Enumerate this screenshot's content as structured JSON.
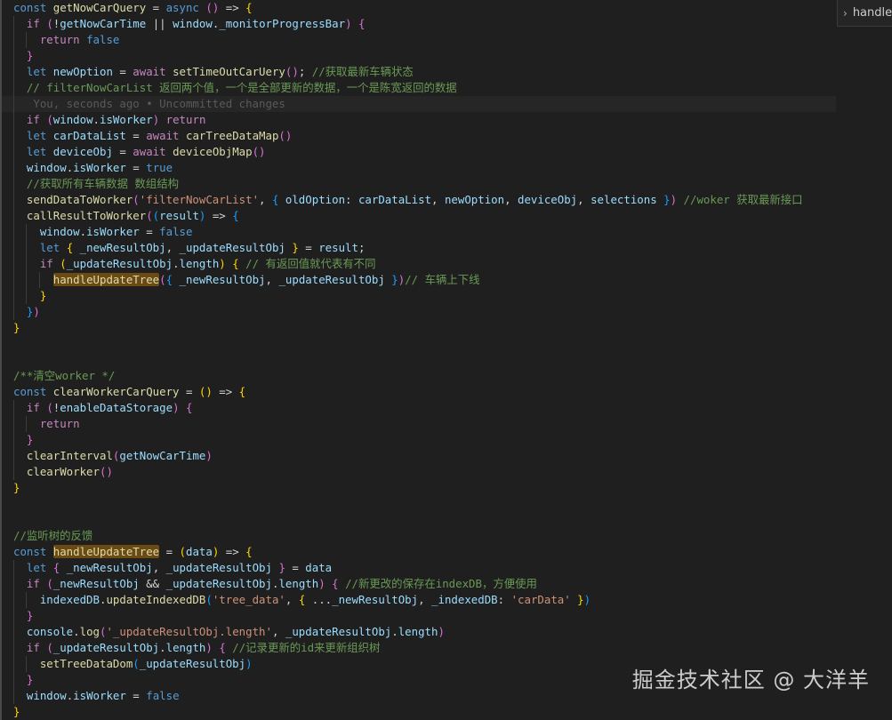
{
  "breadcrumb": {
    "label": "handle"
  },
  "watermark": "掘金技术社区 @ 大洋羊",
  "code_lines": [
    {
      "indent": 0,
      "current": false,
      "tokens": [
        [
          "kw",
          "const "
        ],
        [
          "fn",
          "getNowCarQuery"
        ],
        [
          "p",
          " = "
        ],
        [
          "kw",
          "async "
        ],
        [
          "b2",
          "()"
        ],
        [
          "p",
          " => "
        ],
        [
          "b1",
          "{"
        ]
      ]
    },
    {
      "indent": 1,
      "current": false,
      "tokens": [
        [
          "ctl",
          "if "
        ],
        [
          "b2",
          "("
        ],
        [
          "p",
          "!"
        ],
        [
          "var",
          "getNowCarTime"
        ],
        [
          "p",
          " || "
        ],
        [
          "var",
          "window"
        ],
        [
          "p",
          "."
        ],
        [
          "var",
          "_monitorProgressBar"
        ],
        [
          "b2",
          ")"
        ],
        [
          "p",
          " "
        ],
        [
          "b2",
          "{"
        ]
      ]
    },
    {
      "indent": 2,
      "current": false,
      "tokens": [
        [
          "ctl",
          "return "
        ],
        [
          "bool",
          "false"
        ]
      ]
    },
    {
      "indent": 1,
      "current": false,
      "tokens": [
        [
          "b2",
          "}"
        ]
      ]
    },
    {
      "indent": 1,
      "current": false,
      "tokens": [
        [
          "kw",
          "let "
        ],
        [
          "var",
          "newOption"
        ],
        [
          "p",
          " = "
        ],
        [
          "ctl",
          "await "
        ],
        [
          "fn",
          "setTimeOutCarUery"
        ],
        [
          "b2",
          "()"
        ],
        [
          "p",
          "; "
        ],
        [
          "cmt",
          "//获取最新车辆状态"
        ]
      ]
    },
    {
      "indent": 1,
      "current": false,
      "tokens": [
        [
          "cmt",
          "// filterNowCarList 返回两个值，一个是全部更新的数据，一个是陈宽返回的数据"
        ]
      ]
    },
    {
      "indent": 1,
      "current": true,
      "tokens": [
        [
          "blame",
          " You, seconds ago • Uncommitted changes"
        ]
      ]
    },
    {
      "indent": 1,
      "current": false,
      "tokens": [
        [
          "ctl",
          "if "
        ],
        [
          "b2",
          "("
        ],
        [
          "var",
          "window"
        ],
        [
          "p",
          "."
        ],
        [
          "var",
          "isWorker"
        ],
        [
          "b2",
          ")"
        ],
        [
          "p",
          " "
        ],
        [
          "ctl",
          "return"
        ]
      ]
    },
    {
      "indent": 1,
      "current": false,
      "tokens": [
        [
          "kw",
          "let "
        ],
        [
          "var",
          "carDataList"
        ],
        [
          "p",
          " = "
        ],
        [
          "ctl",
          "await "
        ],
        [
          "fn",
          "carTreeDataMap"
        ],
        [
          "b2",
          "()"
        ]
      ]
    },
    {
      "indent": 1,
      "current": false,
      "tokens": [
        [
          "kw",
          "let "
        ],
        [
          "var",
          "deviceObj"
        ],
        [
          "p",
          " = "
        ],
        [
          "ctl",
          "await "
        ],
        [
          "fn",
          "deviceObjMap"
        ],
        [
          "b2",
          "()"
        ]
      ]
    },
    {
      "indent": 1,
      "current": false,
      "tokens": [
        [
          "var",
          "window"
        ],
        [
          "p",
          "."
        ],
        [
          "var",
          "isWorker"
        ],
        [
          "p",
          " = "
        ],
        [
          "bool",
          "true"
        ]
      ]
    },
    {
      "indent": 1,
      "current": false,
      "tokens": [
        [
          "cmt",
          "//获取所有车辆数据 数组结构"
        ]
      ]
    },
    {
      "indent": 1,
      "current": false,
      "tokens": [
        [
          "fn",
          "sendDataToWorker"
        ],
        [
          "b2",
          "("
        ],
        [
          "str",
          "'filterNowCarList'"
        ],
        [
          "p",
          ", "
        ],
        [
          "b3",
          "{"
        ],
        [
          "p",
          " "
        ],
        [
          "var",
          "oldOption"
        ],
        [
          "p",
          ": "
        ],
        [
          "var",
          "carDataList"
        ],
        [
          "p",
          ", "
        ],
        [
          "var",
          "newOption"
        ],
        [
          "p",
          ", "
        ],
        [
          "var",
          "deviceObj"
        ],
        [
          "p",
          ", "
        ],
        [
          "var",
          "selections"
        ],
        [
          "p",
          " "
        ],
        [
          "b3",
          "}"
        ],
        [
          "b2",
          ")"
        ],
        [
          "p",
          " "
        ],
        [
          "cmt",
          "//woker 获取最新接口"
        ]
      ]
    },
    {
      "indent": 1,
      "current": false,
      "tokens": [
        [
          "fn",
          "callResultToWorker"
        ],
        [
          "b2",
          "("
        ],
        [
          "b3",
          "("
        ],
        [
          "var",
          "result"
        ],
        [
          "b3",
          ")"
        ],
        [
          "p",
          " => "
        ],
        [
          "b3",
          "{"
        ]
      ]
    },
    {
      "indent": 2,
      "current": false,
      "tokens": [
        [
          "var",
          "window"
        ],
        [
          "p",
          "."
        ],
        [
          "var",
          "isWorker"
        ],
        [
          "p",
          " = "
        ],
        [
          "bool",
          "false"
        ]
      ]
    },
    {
      "indent": 2,
      "current": false,
      "tokens": [
        [
          "kw",
          "let "
        ],
        [
          "b1",
          "{"
        ],
        [
          "p",
          " "
        ],
        [
          "var",
          "_newResultObj"
        ],
        [
          "p",
          ", "
        ],
        [
          "var",
          "_updateResultObj"
        ],
        [
          "p",
          " "
        ],
        [
          "b1",
          "}"
        ],
        [
          "p",
          " = "
        ],
        [
          "var",
          "result"
        ],
        [
          "p",
          ";"
        ]
      ]
    },
    {
      "indent": 2,
      "current": false,
      "tokens": [
        [
          "ctl",
          "if "
        ],
        [
          "b1",
          "("
        ],
        [
          "var",
          "_updateResultObj"
        ],
        [
          "p",
          "."
        ],
        [
          "var",
          "length"
        ],
        [
          "b1",
          ")"
        ],
        [
          "p",
          " "
        ],
        [
          "b1",
          "{"
        ],
        [
          "p",
          " "
        ],
        [
          "cmt",
          "// 有返回值就代表有不同"
        ]
      ]
    },
    {
      "indent": 3,
      "current": false,
      "tokens": [
        [
          "hl",
          "handleUpdateTree"
        ],
        [
          "b2",
          "("
        ],
        [
          "b3",
          "{"
        ],
        [
          "p",
          " "
        ],
        [
          "var",
          "_newResultObj"
        ],
        [
          "p",
          ", "
        ],
        [
          "var",
          "_updateResultObj"
        ],
        [
          "p",
          " "
        ],
        [
          "b3",
          "}"
        ],
        [
          "b2",
          ")"
        ],
        [
          "cmt",
          "// 车辆上下线"
        ]
      ]
    },
    {
      "indent": 2,
      "current": false,
      "tokens": [
        [
          "b1",
          "}"
        ]
      ]
    },
    {
      "indent": 1,
      "current": false,
      "tokens": [
        [
          "b3",
          "}"
        ],
        [
          "b2",
          ")"
        ]
      ]
    },
    {
      "indent": 0,
      "current": false,
      "tokens": [
        [
          "b1",
          "}"
        ]
      ]
    },
    {
      "indent": 0,
      "current": false,
      "tokens": []
    },
    {
      "indent": 0,
      "current": false,
      "tokens": []
    },
    {
      "indent": 0,
      "current": false,
      "tokens": [
        [
          "cmt",
          "/**清空worker */"
        ]
      ]
    },
    {
      "indent": 0,
      "current": false,
      "tokens": [
        [
          "kw",
          "const "
        ],
        [
          "fn",
          "clearWorkerCarQuery"
        ],
        [
          "p",
          " = "
        ],
        [
          "b1",
          "()"
        ],
        [
          "p",
          " => "
        ],
        [
          "b1",
          "{"
        ]
      ]
    },
    {
      "indent": 1,
      "current": false,
      "tokens": [
        [
          "ctl",
          "if "
        ],
        [
          "b2",
          "("
        ],
        [
          "p",
          "!"
        ],
        [
          "var",
          "enableDataStorage"
        ],
        [
          "b2",
          ")"
        ],
        [
          "p",
          " "
        ],
        [
          "b2",
          "{"
        ]
      ]
    },
    {
      "indent": 2,
      "current": false,
      "tokens": [
        [
          "ctl",
          "return"
        ]
      ]
    },
    {
      "indent": 1,
      "current": false,
      "tokens": [
        [
          "b2",
          "}"
        ]
      ]
    },
    {
      "indent": 1,
      "current": false,
      "tokens": [
        [
          "fn",
          "clearInterval"
        ],
        [
          "b2",
          "("
        ],
        [
          "var",
          "getNowCarTime"
        ],
        [
          "b2",
          ")"
        ]
      ]
    },
    {
      "indent": 1,
      "current": false,
      "tokens": [
        [
          "fn",
          "clearWorker"
        ],
        [
          "b2",
          "()"
        ]
      ]
    },
    {
      "indent": 0,
      "current": false,
      "tokens": [
        [
          "b1",
          "}"
        ]
      ]
    },
    {
      "indent": 0,
      "current": false,
      "tokens": []
    },
    {
      "indent": 0,
      "current": false,
      "tokens": []
    },
    {
      "indent": 0,
      "current": false,
      "tokens": [
        [
          "cmt",
          "//监听树的反馈"
        ]
      ]
    },
    {
      "indent": 0,
      "current": false,
      "tokens": [
        [
          "kw",
          "const "
        ],
        [
          "hl",
          "handleUpdateTree"
        ],
        [
          "p",
          " = "
        ],
        [
          "b1",
          "("
        ],
        [
          "var",
          "data"
        ],
        [
          "b1",
          ")"
        ],
        [
          "p",
          " => "
        ],
        [
          "b1",
          "{"
        ]
      ]
    },
    {
      "indent": 1,
      "current": false,
      "tokens": [
        [
          "kw",
          "let "
        ],
        [
          "b2",
          "{"
        ],
        [
          "p",
          " "
        ],
        [
          "var",
          "_newResultObj"
        ],
        [
          "p",
          ", "
        ],
        [
          "var",
          "_updateResultObj"
        ],
        [
          "p",
          " "
        ],
        [
          "b2",
          "}"
        ],
        [
          "p",
          " = "
        ],
        [
          "var",
          "data"
        ]
      ]
    },
    {
      "indent": 1,
      "current": false,
      "tokens": [
        [
          "ctl",
          "if "
        ],
        [
          "b2",
          "("
        ],
        [
          "var",
          "_newResultObj"
        ],
        [
          "p",
          " && "
        ],
        [
          "var",
          "_updateResultObj"
        ],
        [
          "p",
          "."
        ],
        [
          "var",
          "length"
        ],
        [
          "b2",
          ")"
        ],
        [
          "p",
          " "
        ],
        [
          "b2",
          "{"
        ],
        [
          "p",
          " "
        ],
        [
          "cmt",
          "//新更改的保存在indexDB，方便使用"
        ]
      ]
    },
    {
      "indent": 2,
      "current": false,
      "tokens": [
        [
          "var",
          "indexedDB"
        ],
        [
          "p",
          "."
        ],
        [
          "fn",
          "updateIndexedDB"
        ],
        [
          "b3",
          "("
        ],
        [
          "str",
          "'tree_data'"
        ],
        [
          "p",
          ", "
        ],
        [
          "b1",
          "{"
        ],
        [
          "p",
          " ..."
        ],
        [
          "var",
          "_newResultObj"
        ],
        [
          "p",
          ", "
        ],
        [
          "var",
          "_indexedDB"
        ],
        [
          "p",
          ": "
        ],
        [
          "str",
          "'carData'"
        ],
        [
          "p",
          " "
        ],
        [
          "b1",
          "}"
        ],
        [
          "b3",
          ")"
        ]
      ]
    },
    {
      "indent": 1,
      "current": false,
      "tokens": [
        [
          "b2",
          "}"
        ]
      ]
    },
    {
      "indent": 1,
      "current": false,
      "tokens": [
        [
          "var",
          "console"
        ],
        [
          "p",
          "."
        ],
        [
          "fn",
          "log"
        ],
        [
          "b2",
          "("
        ],
        [
          "str",
          "'_updateResultObj.length'"
        ],
        [
          "p",
          ", "
        ],
        [
          "var",
          "_updateResultObj"
        ],
        [
          "p",
          "."
        ],
        [
          "var",
          "length"
        ],
        [
          "b2",
          ")"
        ]
      ]
    },
    {
      "indent": 1,
      "current": false,
      "tokens": [
        [
          "ctl",
          "if "
        ],
        [
          "b2",
          "("
        ],
        [
          "var",
          "_updateResultObj"
        ],
        [
          "p",
          "."
        ],
        [
          "var",
          "length"
        ],
        [
          "b2",
          ")"
        ],
        [
          "p",
          " "
        ],
        [
          "b2",
          "{"
        ],
        [
          "p",
          " "
        ],
        [
          "cmt",
          "//记录更新的id来更新组织树"
        ]
      ]
    },
    {
      "indent": 2,
      "current": false,
      "tokens": [
        [
          "fn",
          "setTreeDataDom"
        ],
        [
          "b3",
          "("
        ],
        [
          "var",
          "_updateResultObj"
        ],
        [
          "b3",
          ")"
        ]
      ]
    },
    {
      "indent": 1,
      "current": false,
      "tokens": [
        [
          "b2",
          "}"
        ]
      ]
    },
    {
      "indent": 1,
      "current": false,
      "tokens": [
        [
          "var",
          "window"
        ],
        [
          "p",
          "."
        ],
        [
          "var",
          "isWorker"
        ],
        [
          "p",
          " = "
        ],
        [
          "bool",
          "false"
        ]
      ]
    },
    {
      "indent": 0,
      "current": false,
      "tokens": [
        [
          "b1",
          "}"
        ]
      ]
    }
  ]
}
